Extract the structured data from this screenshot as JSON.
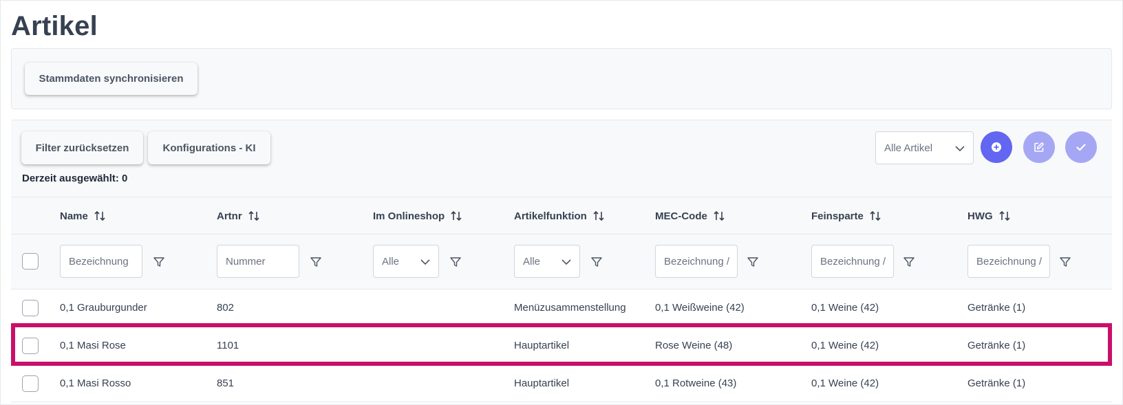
{
  "page": {
    "title": "Artikel"
  },
  "sync": {
    "button_label": "Stammdaten synchronisieren"
  },
  "toolbar": {
    "filter_reset_label": "Filter zurücksetzen",
    "ki_label": "Konfigurations - KI",
    "selected_label": "Derzeit ausgewählt: 0",
    "article_select_value": "Alle Artikel",
    "icons": {
      "add": "plus-circle-icon",
      "edit": "edit-icon",
      "check": "check-icon"
    },
    "colors": {
      "primary": "#6366f1",
      "primary_light": "#a5a7f5"
    }
  },
  "table": {
    "columns": [
      {
        "label": "Name",
        "filter_type": "text",
        "filter_placeholder": "Bezeichnung"
      },
      {
        "label": "Artnr",
        "filter_type": "text",
        "filter_placeholder": "Nummer"
      },
      {
        "label": "Im Onlineshop",
        "filter_type": "dropdown",
        "filter_value": "Alle"
      },
      {
        "label": "Artikelfunktion",
        "filter_type": "dropdown",
        "filter_value": "Alle"
      },
      {
        "label": "MEC-Code",
        "filter_type": "text",
        "filter_placeholder": "Bezeichnung /"
      },
      {
        "label": "Feinsparte",
        "filter_type": "text",
        "filter_placeholder": "Bezeichnung /"
      },
      {
        "label": "HWG",
        "filter_type": "text",
        "filter_placeholder": "Bezeichnung /"
      }
    ],
    "rows": [
      {
        "name": "0,1 Grauburgunder",
        "artnr": "802",
        "onlineshop": "",
        "funktion": "Menüzusammenstellung",
        "mec": "0,1 Weißweine (42)",
        "feinsparte": "0,1 Weine (42)",
        "hwg": "Getränke (1)",
        "highlighted": false
      },
      {
        "name": "0,1 Masi Rose",
        "artnr": "1101",
        "onlineshop": "",
        "funktion": "Hauptartikel",
        "mec": "Rose Weine (48)",
        "feinsparte": "0,1 Weine (42)",
        "hwg": "Getränke (1)",
        "highlighted": true
      },
      {
        "name": "0,1 Masi Rosso",
        "artnr": "851",
        "onlineshop": "",
        "funktion": "Hauptartikel",
        "mec": "0,1 Rotweine (43)",
        "feinsparte": "0,1 Weine (42)",
        "hwg": "Getränke (1)",
        "highlighted": false
      }
    ],
    "highlight_color": "#c8106a"
  }
}
